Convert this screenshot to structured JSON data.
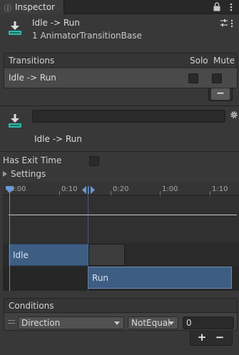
{
  "tab": {
    "label": "Inspector",
    "icon": "info-icon"
  },
  "header": {
    "title": "Idle -> Run",
    "subtitle": "1 AnimatorTransitionBase",
    "icon": "transition-download-icon"
  },
  "transitions": {
    "title": "Transitions",
    "solo_label": "Solo",
    "mute_label": "Mute",
    "rows": [
      {
        "label": "Idle -> Run",
        "solo": false,
        "mute": false
      }
    ],
    "remove_label": "−"
  },
  "detail": {
    "name_value": "",
    "label": "Idle -> Run",
    "icon": "transition-download-icon"
  },
  "has_exit_time": {
    "label": "Has Exit Time",
    "checked": false
  },
  "settings": {
    "label": "Settings",
    "expanded": false
  },
  "timeline": {
    "ticks": [
      "0:00",
      "0:10",
      "0:20",
      "1:00",
      "1:10"
    ],
    "source_state": "Idle",
    "destination_state": "Run",
    "colors": {
      "state_bar": "#3e5d83",
      "marker": "#6a8fbf"
    }
  },
  "conditions": {
    "title": "Conditions",
    "items": [
      {
        "parameter": "Direction",
        "mode": "NotEqual",
        "value": "0"
      }
    ],
    "add_label": "+",
    "remove_label": "−"
  }
}
